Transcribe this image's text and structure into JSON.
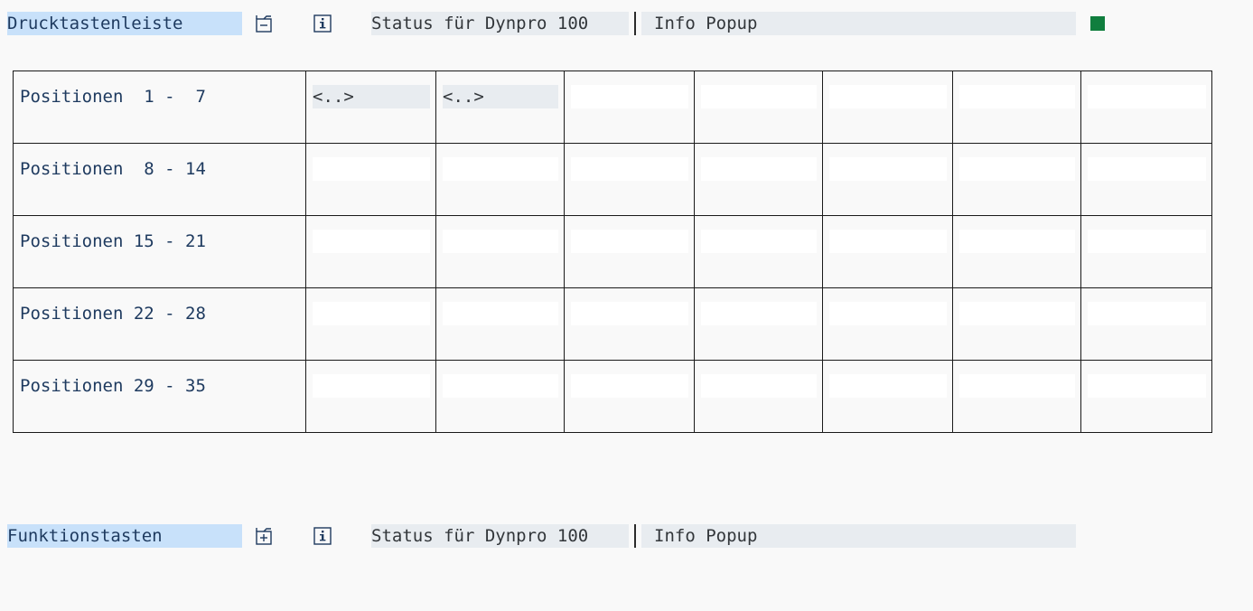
{
  "sections": [
    {
      "label": "Drucktastenleiste",
      "action_icon": "toolbar-icon",
      "info_icon": "info-icon",
      "status": "Status für Dynpro 100",
      "popup": "Info Popup",
      "indicator_color": "#107e3e"
    },
    {
      "label": "Funktionstasten",
      "action_icon": "add-function-icon",
      "info_icon": "info-icon",
      "status": "Status für Dynpro 100",
      "popup": "Info Popup"
    }
  ],
  "grid": {
    "rows": [
      {
        "label": "Positionen  1 -  7",
        "cells": [
          "<..>",
          "<..>",
          "",
          "",
          "",
          "",
          ""
        ]
      },
      {
        "label": "Positionen  8 - 14",
        "cells": [
          "",
          "",
          "",
          "",
          "",
          "",
          ""
        ]
      },
      {
        "label": "Positionen 15 - 21",
        "cells": [
          "",
          "",
          "",
          "",
          "",
          "",
          ""
        ]
      },
      {
        "label": "Positionen 22 - 28",
        "cells": [
          "",
          "",
          "",
          "",
          "",
          "",
          ""
        ]
      },
      {
        "label": "Positionen 29 - 35",
        "cells": [
          "",
          "",
          "",
          "",
          "",
          "",
          ""
        ]
      }
    ]
  },
  "colors": {
    "label_bg": "#c8e1fa",
    "field_bg": "#e8ecf0",
    "text": "#1e3a5f",
    "indicator": "#107e3e"
  }
}
